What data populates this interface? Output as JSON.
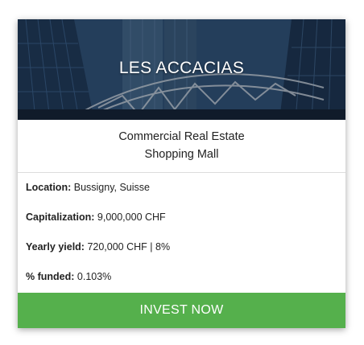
{
  "card": {
    "title": "LES ACCACIAS",
    "category_line1": "Commercial Real Estate",
    "category_line2": "Shopping Mall",
    "details": {
      "location_label": "Location:",
      "location_value": "Bussigny, Suisse",
      "capitalization_label": "Capitalization:",
      "capitalization_value": "9,000,000 CHF",
      "yield_label": "Yearly yield:",
      "yield_value": "720,000 CHF | 8%",
      "funded_label": "% funded:",
      "funded_value": "0.103%"
    },
    "cta_label": "INVEST NOW"
  },
  "colors": {
    "cta_green": "#55b04c",
    "hero_blue": "#2c4a6d"
  }
}
